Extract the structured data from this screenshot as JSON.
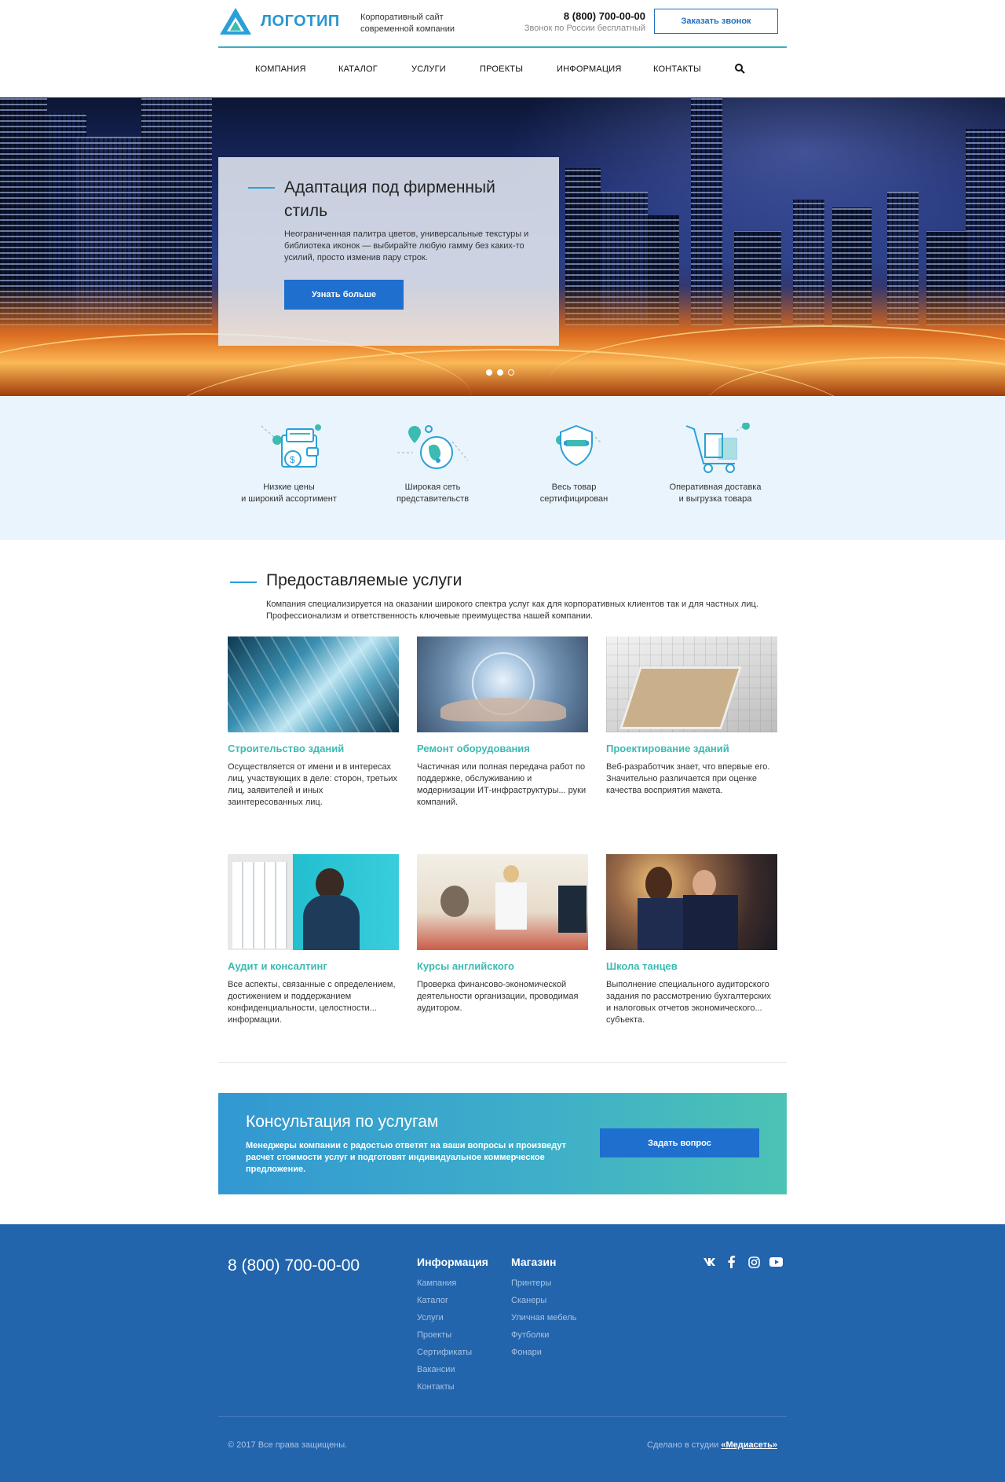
{
  "header": {
    "logo_text": "ЛОГОТИП",
    "tagline": "Корпоративный сайт современной компании",
    "phone": "8 (800) 700-00-00",
    "phone_note": "Звонок по России бесплатный",
    "callback_label": "Заказать звонок"
  },
  "nav": {
    "items": [
      "КОМПАНИЯ",
      "КАТАЛОГ",
      "УСЛУГИ",
      "ПРОЕКТЫ",
      "ИНФОРМАЦИЯ",
      "КОНТАКТЫ"
    ],
    "search_icon": "search-icon"
  },
  "hero": {
    "title": "Адаптация под фирменный стиль",
    "text": "Неограниченная палитра цветов, универсальные текстуры и библиотека иконок — выбирайте любую гамму без каких-то усилий, просто изменив пару строк.",
    "button_label": "Узнать больше",
    "slides_total": 3,
    "active_slide": 2
  },
  "features": [
    {
      "icon": "wallet-icon",
      "label": "Низкие цены\nи широкий ассортимент"
    },
    {
      "icon": "globe-icon",
      "label": "Широкая сеть\nпредставительств"
    },
    {
      "icon": "shield-icon",
      "label": "Весь товар\nсертифицирован"
    },
    {
      "icon": "cart-icon",
      "label": "Оперативная доставка\nи выгрузка товара"
    }
  ],
  "services": {
    "title": "Предоставляемые услуги",
    "intro": "Компания специализируется на оказании широкого спектра услуг как для корпоративных клиентов так и для частных лиц. Профессионализм и ответственность ключевые преимущества нашей компании.",
    "cards": [
      {
        "title": "Строительство зданий",
        "text": "Осуществляется от имени и в интересах лиц, участвующих в деле: сторон, третьих лиц, заявителей и иных заинтересованных лиц."
      },
      {
        "title": "Ремонт оборудования",
        "text": "Частичная или полная передача работ по поддержке, обслуживанию и модернизации ИТ-инфраструктуры... руки компаний."
      },
      {
        "title": "Проектирование зданий",
        "text": "Веб-разработчик знает, что впервые его. Значительно различается при оценке качества восприятия макета."
      },
      {
        "title": "Аудит и консалтинг",
        "text": "Все аспекты, связанные с определением, достижением и поддержанием конфиденциальности, целостности... информации."
      },
      {
        "title": "Курсы английского",
        "text": "Проверка финансово-экономической деятельности организации, проводимая аудитором."
      },
      {
        "title": "Школа танцев",
        "text": "Выполнение специального аудиторского задания по рассмотрению бухгалтерских и налоговых отчетов экономического... субъекта."
      }
    ]
  },
  "consult": {
    "title": "Консультация по услугам",
    "text": "Менеджеры компании с радостью ответят на ваши вопросы и произведут расчет стоимости услуг и подготовят индивидуальное коммерческое предложение.",
    "button_label": "Задать вопрос"
  },
  "footer": {
    "phone": "8 (800) 700-00-00",
    "info_title": "Информация",
    "info_links": [
      "Кампания",
      "Каталог",
      "Услуги",
      "Проекты",
      "Сертификаты",
      "Вакансии",
      "Контакты"
    ],
    "shop_title": "Магазин",
    "shop_links": [
      "Принтеры",
      "Сканеры",
      "Уличная мебель",
      "Футболки",
      "Фонари"
    ],
    "social_icons": [
      "vk-icon",
      "facebook-icon",
      "instagram-icon",
      "youtube-icon"
    ],
    "copyright": "© 2017 Все права защищены.",
    "made_by": "Сделано в студии",
    "studio": "«Медиасеть»"
  },
  "colors": {
    "accent": "#2aa0d8",
    "button": "#1f6fcf",
    "teal_title": "#3bbbb2",
    "footer_bg": "#2265ad",
    "features_bg": "#eaf4fc"
  }
}
